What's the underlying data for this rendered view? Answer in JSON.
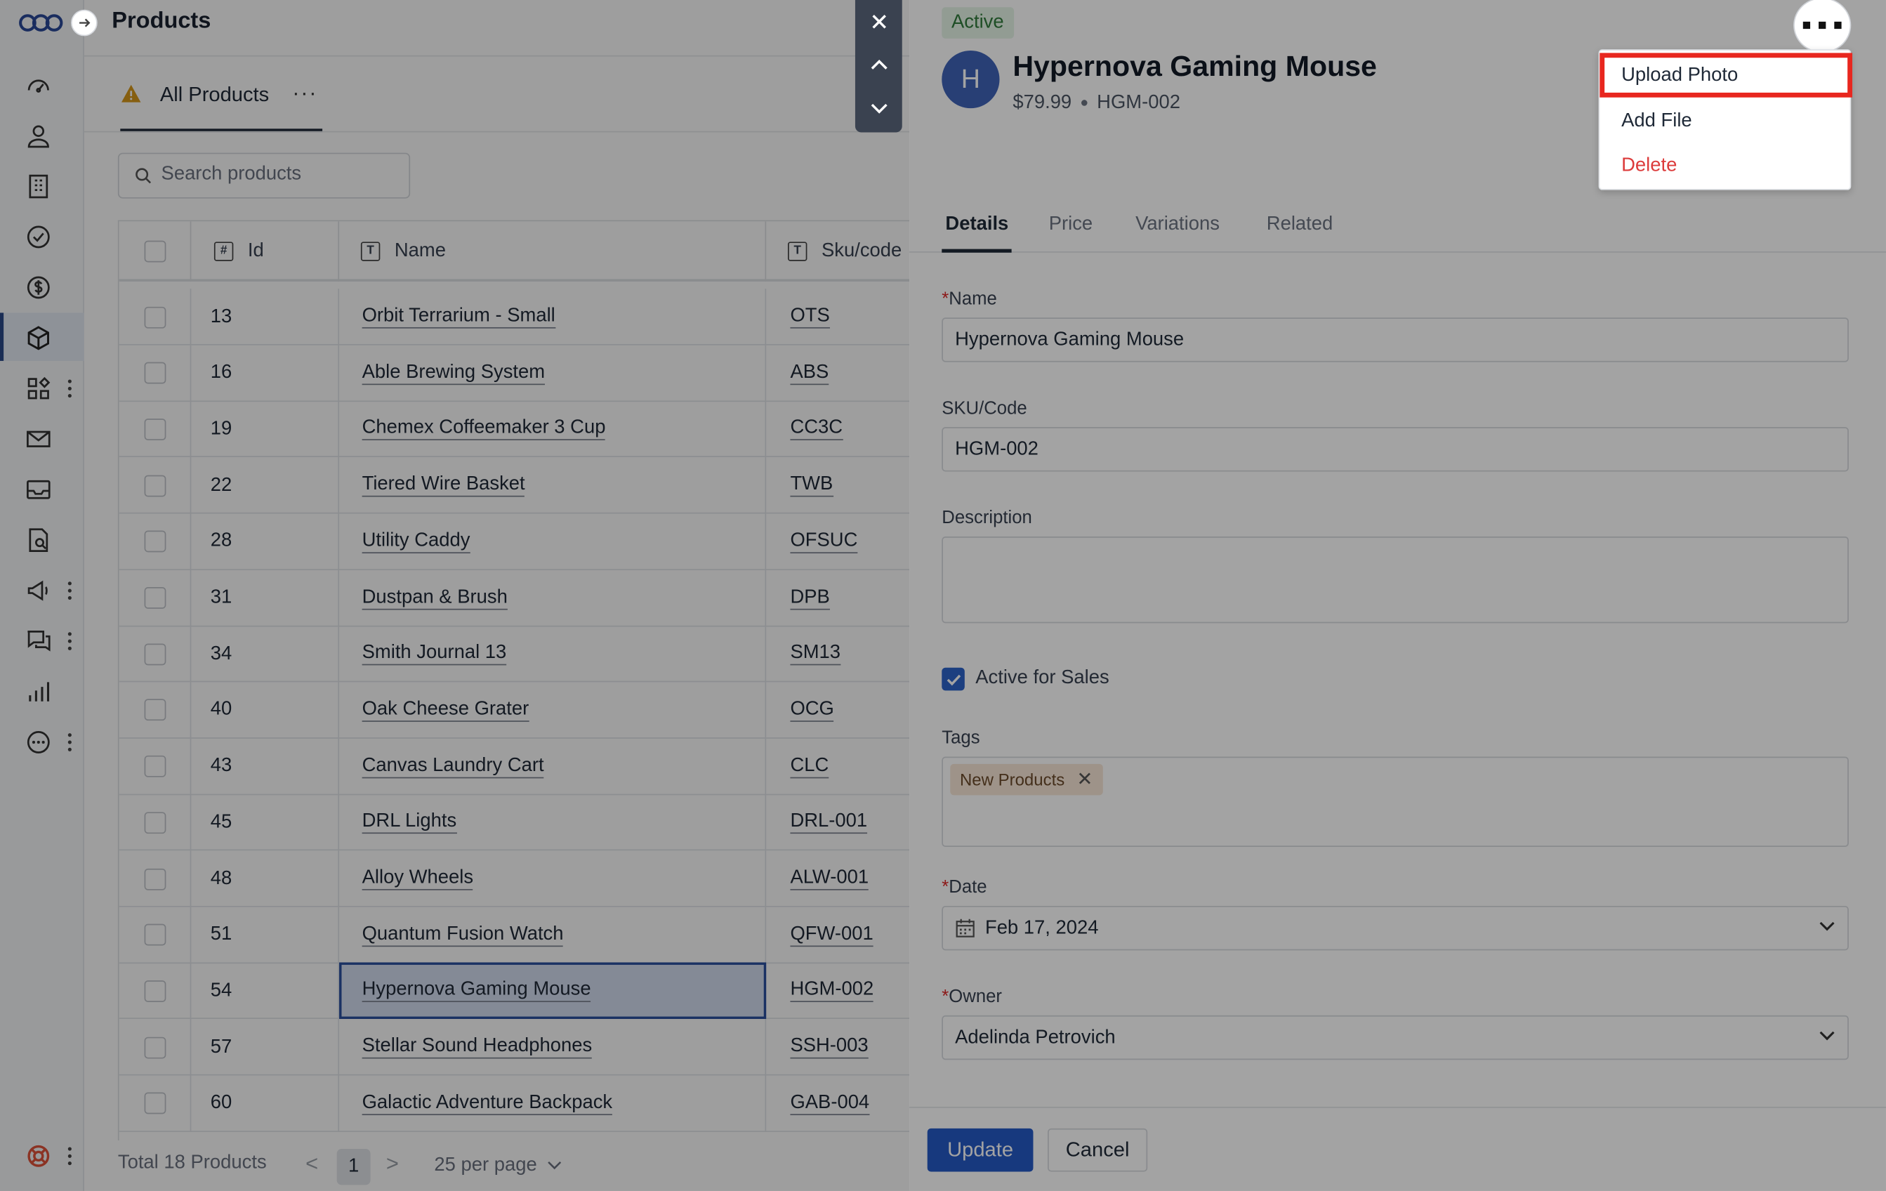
{
  "page": {
    "title": "Products"
  },
  "list": {
    "tab_label": "All Products",
    "tab_more": "···",
    "search_placeholder": "Search products",
    "columns": {
      "id": "Id",
      "name": "Name",
      "sku": "Sku/code"
    },
    "column_icons": {
      "id": "#",
      "name": "T",
      "sku": "T"
    },
    "rows": [
      {
        "id": "13",
        "name": "Orbit Terrarium - Small",
        "sku": "OTS"
      },
      {
        "id": "16",
        "name": "Able Brewing System",
        "sku": "ABS"
      },
      {
        "id": "19",
        "name": "Chemex Coffeemaker 3 Cup",
        "sku": "CC3C"
      },
      {
        "id": "22",
        "name": "Tiered Wire Basket",
        "sku": "TWB"
      },
      {
        "id": "28",
        "name": "Utility Caddy",
        "sku": "OFSUC"
      },
      {
        "id": "31",
        "name": "Dustpan & Brush",
        "sku": "DPB"
      },
      {
        "id": "34",
        "name": "Smith Journal 13",
        "sku": "SM13"
      },
      {
        "id": "40",
        "name": "Oak Cheese Grater",
        "sku": "OCG"
      },
      {
        "id": "43",
        "name": "Canvas Laundry Cart",
        "sku": "CLC"
      },
      {
        "id": "45",
        "name": "DRL Lights",
        "sku": "DRL-001"
      },
      {
        "id": "48",
        "name": "Alloy Wheels",
        "sku": "ALW-001"
      },
      {
        "id": "51",
        "name": "Quantum Fusion Watch",
        "sku": "QFW-001"
      },
      {
        "id": "54",
        "name": "Hypernova Gaming Mouse",
        "sku": "HGM-002",
        "selected": true
      },
      {
        "id": "57",
        "name": "Stellar Sound Headphones",
        "sku": "SSH-003"
      },
      {
        "id": "60",
        "name": "Galactic Adventure Backpack",
        "sku": "GAB-004"
      }
    ],
    "footer": {
      "total": "Total 18 Products",
      "prev": "<",
      "page": "1",
      "next": ">",
      "per_page": "25 per page"
    }
  },
  "sidebar": {
    "icons": [
      "dashboard-icon",
      "contacts-icon",
      "companies-icon",
      "tasks-icon",
      "deals-icon",
      "products-icon",
      "apps-icon",
      "email-icon",
      "inbox-icon",
      "documents-icon",
      "campaigns-icon",
      "chat-icon",
      "reports-icon",
      "more-icon"
    ],
    "active": "products-icon",
    "help_icon": "help-icon"
  },
  "detail": {
    "status": "Active",
    "avatar_letter": "H",
    "title": "Hypernova Gaming Mouse",
    "price": "$79.99",
    "sku": "HGM-002",
    "tabs": [
      "Details",
      "Price",
      "Variations",
      "Related"
    ],
    "active_tab": "Details",
    "fields": {
      "name_label": "Name",
      "name_value": "Hypernova Gaming Mouse",
      "sku_label": "SKU/Code",
      "sku_value": "HGM-002",
      "description_label": "Description",
      "description_value": "",
      "active_label": "Active for Sales",
      "active_checked": true,
      "tags_label": "Tags",
      "tags": [
        "New Products"
      ],
      "date_label": "Date",
      "date_value": "Feb 17, 2024",
      "owner_label": "Owner",
      "owner_value": "Adelinda Petrovich",
      "required_mark": "*"
    },
    "buttons": {
      "update": "Update",
      "cancel": "Cancel"
    }
  },
  "menu": {
    "items": [
      {
        "label": "Upload Photo",
        "highlighted": true
      },
      {
        "label": "Add File"
      },
      {
        "label": "Delete",
        "danger": true
      }
    ]
  },
  "colors": {
    "accent": "#2459c6",
    "danger": "#dc3b3b",
    "highlight": "#e8271f",
    "status_bg": "#e5f4e7",
    "status_text": "#2f7a3b"
  }
}
